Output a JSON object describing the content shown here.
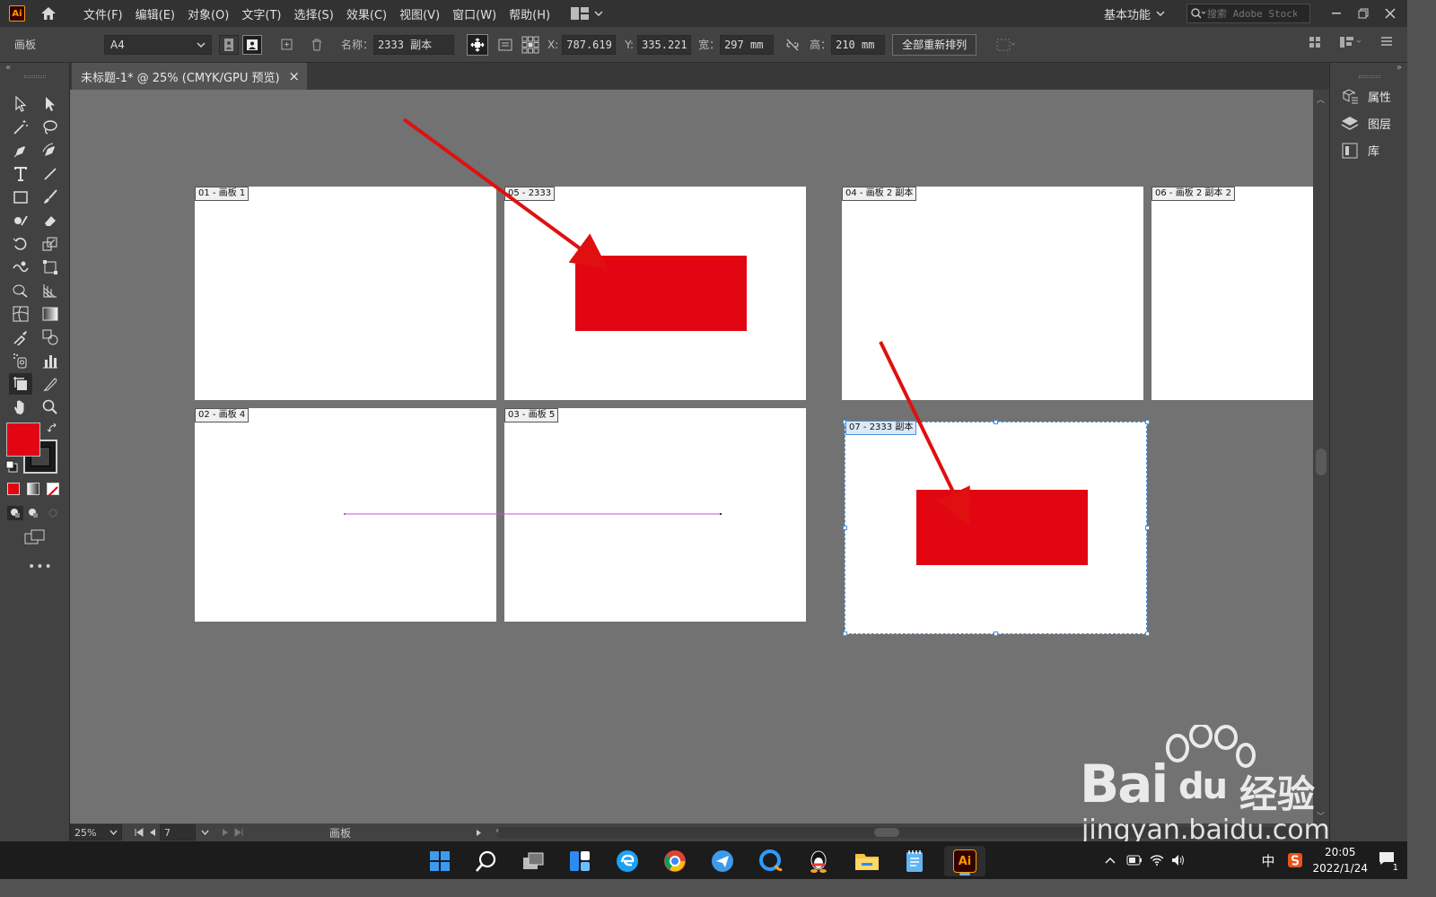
{
  "app": {
    "logo": "Ai"
  },
  "menus": [
    "文件(F)",
    "编辑(E)",
    "对象(O)",
    "文字(T)",
    "选择(S)",
    "效果(C)",
    "视图(V)",
    "窗口(W)",
    "帮助(H)"
  ],
  "workspace": {
    "label": "基本功能"
  },
  "stock_search": {
    "placeholder": "搜索 Adobe Stock"
  },
  "control_bar": {
    "tool_label": "画板",
    "preset": "A4",
    "name_label": "名称：",
    "name_value": "2333 副本",
    "x_label": "X:",
    "x_value": "787.619",
    "y_label": "Y:",
    "y_value": "335.221",
    "w_label": "宽：",
    "w_value": "297 mm",
    "h_label": "高：",
    "h_value": "210 mm",
    "rearrange_label": "全部重新排列"
  },
  "document_tab": {
    "title": "未标题-1* @ 25% (CMYK/GPU 预览)",
    "close": "×"
  },
  "artboards": [
    {
      "label": "01 - 画板 1"
    },
    {
      "label": "05 - 2333"
    },
    {
      "label": "04 - 画板 2 副本"
    },
    {
      "label": "06 - 画板 2 副本 2"
    },
    {
      "label": "02 - 画板 4"
    },
    {
      "label": "03 - 画板 5"
    },
    {
      "label": "07 - 2333 副本"
    }
  ],
  "status_bar": {
    "zoom": "25%",
    "page": "7",
    "mode": "画板"
  },
  "right_panel": {
    "items": [
      "属性",
      "图层",
      "库"
    ]
  },
  "taskbar": {
    "time": "20:05",
    "date": "2022/1/24",
    "ime": "中",
    "notification_count": "1",
    "ai_label": "Ai"
  },
  "watermark": {
    "brand": "Bai",
    "du": "du",
    "jingyan": "经验",
    "url": "jingyan.baidu.com"
  },
  "colors": {
    "fill": "#e20613",
    "accent": "#4a90e2",
    "annotation_arrow": "#e01010"
  }
}
